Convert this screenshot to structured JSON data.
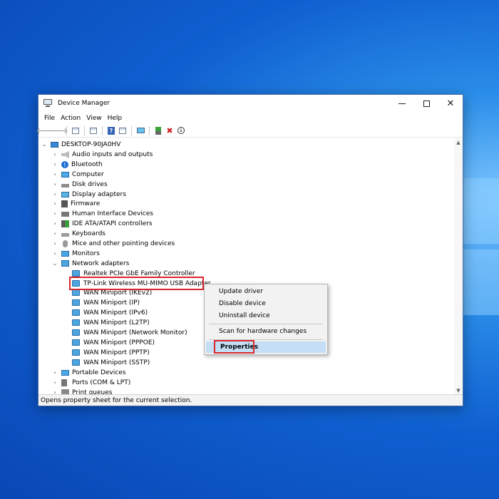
{
  "window": {
    "title": "Device Manager",
    "minimize_icon": "minimize-icon",
    "maximize_icon": "maximize-icon",
    "close_icon": "close-icon"
  },
  "menu": [
    "File",
    "Action",
    "View",
    "Help"
  ],
  "toolbar": [
    "back-arrow-icon",
    "forward-arrow-icon",
    "properties-grid-icon",
    "properties-icon",
    "help-icon",
    "update-driver-icon",
    "scan-monitor-icon",
    "enable-device-icon",
    "uninstall-x-icon",
    "download-icon"
  ],
  "tree": {
    "root": "DESKTOP-90JA0HV",
    "categories": [
      {
        "label": "Audio inputs and outputs",
        "icon": "speaker-icon",
        "expanded": false
      },
      {
        "label": "Bluetooth",
        "icon": "bluetooth-icon",
        "expanded": false
      },
      {
        "label": "Computer",
        "icon": "computer-icon",
        "expanded": false
      },
      {
        "label": "Disk drives",
        "icon": "disk-drive-icon",
        "expanded": false
      },
      {
        "label": "Display adapters",
        "icon": "display-adapter-icon",
        "expanded": false
      },
      {
        "label": "Firmware",
        "icon": "firmware-icon",
        "expanded": false
      },
      {
        "label": "Human Interface Devices",
        "icon": "hid-icon",
        "expanded": false
      },
      {
        "label": "IDE ATA/ATAPI controllers",
        "icon": "ide-controller-icon",
        "expanded": false
      },
      {
        "label": "Keyboards",
        "icon": "keyboard-icon",
        "expanded": false
      },
      {
        "label": "Mice and other pointing devices",
        "icon": "mouse-icon",
        "expanded": false
      },
      {
        "label": "Monitors",
        "icon": "monitor-icon",
        "expanded": false
      },
      {
        "label": "Network adapters",
        "icon": "network-adapter-icon",
        "expanded": true
      },
      {
        "label": "Portable Devices",
        "icon": "portable-device-icon",
        "expanded": false
      },
      {
        "label": "Ports (COM & LPT)",
        "icon": "port-icon",
        "expanded": false
      },
      {
        "label": "Print queues",
        "icon": "printer-icon",
        "expanded": false
      }
    ],
    "network_adapters": [
      "Realtek PCIe GbE Family Controller",
      "TP-Link Wireless MU-MIMO USB Adapter",
      "WAN Miniport (IKEv2)",
      "WAN Miniport (IP)",
      "WAN Miniport (IPv6)",
      "WAN Miniport (L2TP)",
      "WAN Miniport (Network Monitor)",
      "WAN Miniport (PPPOE)",
      "WAN Miniport (PPTP)",
      "WAN Miniport (SSTP)"
    ],
    "selected": "TP-Link Wireless MU-MIMO USB Adapter"
  },
  "context_menu": {
    "items": [
      "Update driver",
      "Disable device",
      "Uninstall device",
      "Scan for hardware changes",
      "Properties"
    ],
    "highlighted": "Properties"
  },
  "status": "Opens property sheet for the current selection.",
  "colors": {
    "highlight_border": "#d9262c",
    "menu_selection": "#c3def5",
    "desktop": "#0f5fd0"
  }
}
